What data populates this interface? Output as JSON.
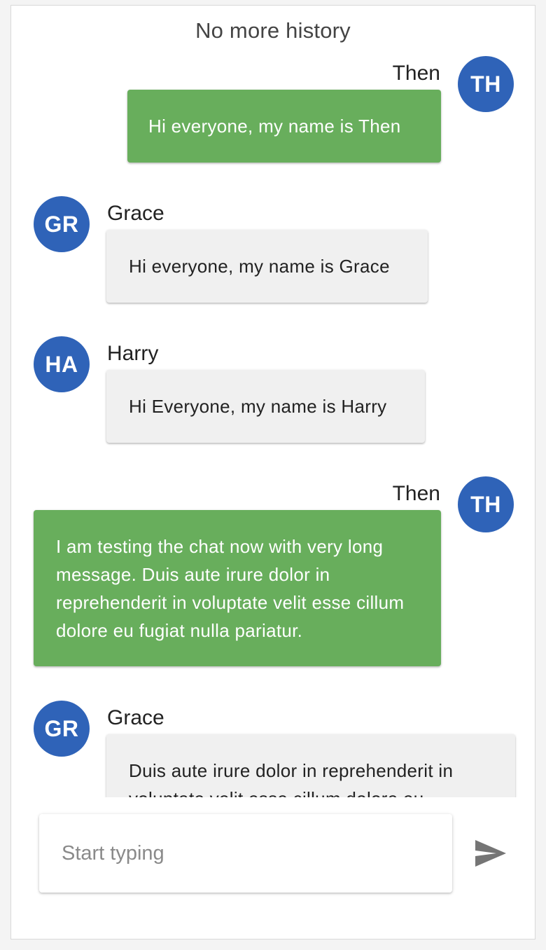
{
  "history_label": "No more history",
  "messages": [
    {
      "initials": "TH",
      "sender": "Then",
      "text": "Hi everyone, my name is Then",
      "mine": true
    },
    {
      "initials": "GR",
      "sender": "Grace",
      "text": "Hi everyone, my name is Grace",
      "mine": false
    },
    {
      "initials": "HA",
      "sender": "Harry",
      "text": "Hi Everyone, my name is Harry",
      "mine": false
    },
    {
      "initials": "TH",
      "sender": "Then",
      "text": "I am testing the chat now with very long message. Duis aute irure dolor in reprehenderit in voluptate velit esse cillum dolore eu fugiat nulla pariatur.",
      "mine": true
    },
    {
      "initials": "GR",
      "sender": "Grace",
      "text": "Duis aute irure dolor in reprehenderit in voluptate velit esse cillum dolore eu",
      "mine": false
    }
  ],
  "composer": {
    "placeholder": "Start typing",
    "send_icon": "send-icon"
  },
  "colors": {
    "avatar": "#2f63b8",
    "own_bubble": "#68ae5c",
    "other_bubble": "#f0f0f0"
  }
}
